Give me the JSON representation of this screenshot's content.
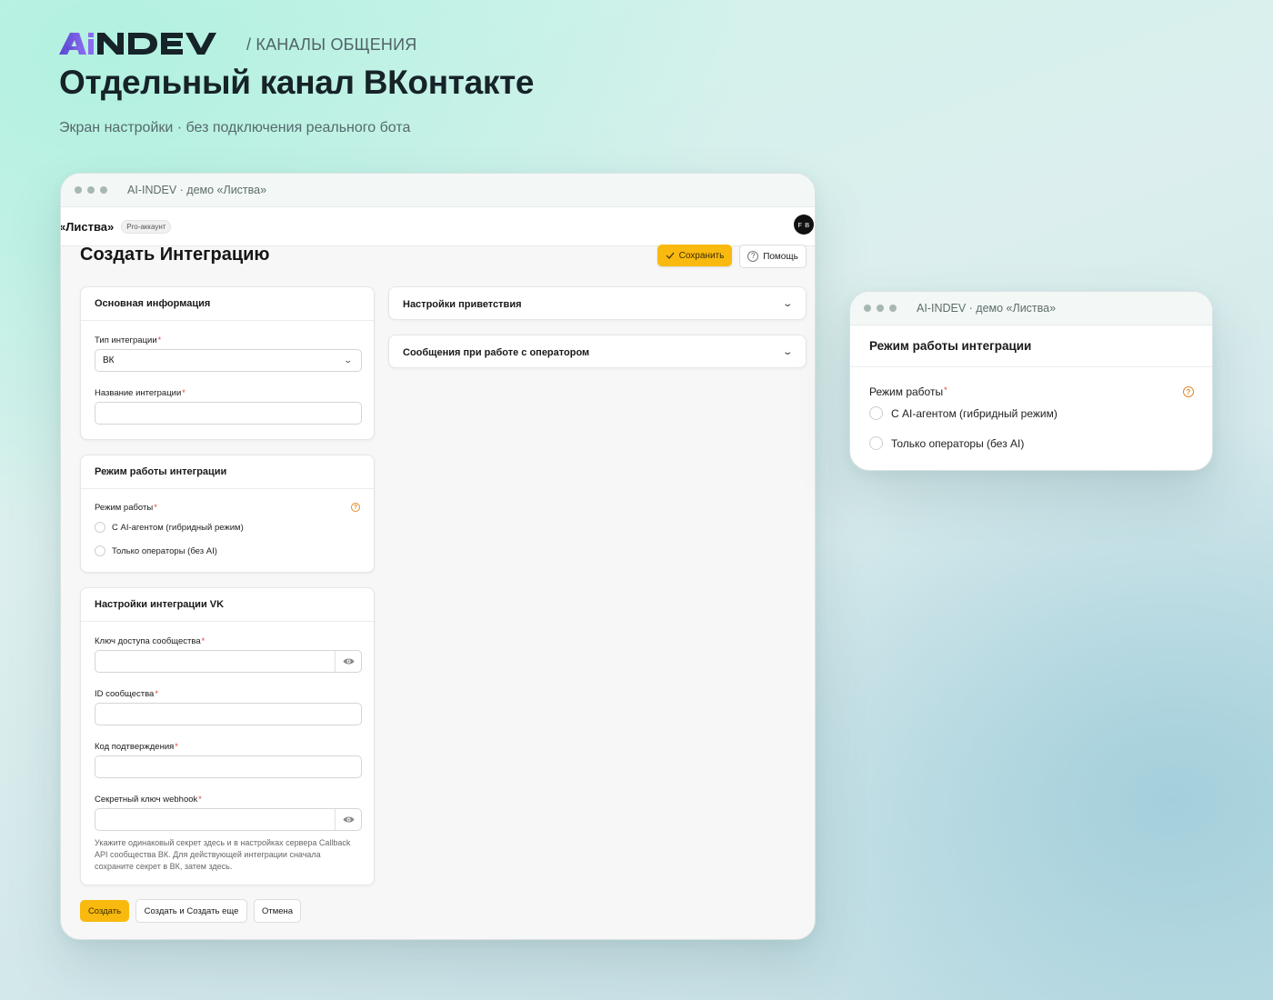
{
  "header": {
    "logo_text": "AiNDEV",
    "breadcrumb": "/ КАНАЛЫ ОБЩЕНИЯ",
    "title": "Отдельный канал ВКонтакте",
    "subtitle": "Экран настройки · без подключения реального бота"
  },
  "main_window": {
    "titlebar": "AI-INDEV · демо «Листва»",
    "org_name": "«Листва»",
    "account_badge": "Pro-аккаунт",
    "avatar_initials": "F B",
    "page_title": "Создать Интеграцию",
    "save_label": "Сохранить",
    "help_label": "Помощь",
    "basic_info": {
      "title": "Основная информация",
      "type_label": "Тип интеграции",
      "type_value": "ВК",
      "name_label": "Название интеграции",
      "name_value": ""
    },
    "mode": {
      "title": "Режим работы интеграции",
      "label": "Режим работы",
      "options": [
        "С AI-агентом (гибридный режим)",
        "Только операторы (без AI)"
      ]
    },
    "vk": {
      "title": "Настройки интеграции VK",
      "access_key_label": "Ключ доступа сообщества",
      "community_id_label": "ID сообщества",
      "confirm_code_label": "Код подтверждения",
      "secret_label": "Секретный ключ webhook",
      "hint": "Укажите одинаковый секрет здесь и в настройках сервера Callback API сообщества ВК. Для действующей интеграции сначала сохраните секрет в ВК, затем здесь."
    },
    "accordions": [
      "Настройки приветствия",
      "Сообщения при работе с оператором"
    ],
    "footer_buttons": {
      "create": "Создать",
      "create_more": "Создать и Создать еще",
      "cancel": "Отмена"
    }
  },
  "popup_window": {
    "titlebar": "AI-INDEV · демо «Листва»",
    "title": "Режим работы интеграции",
    "label": "Режим работы",
    "options": [
      "С AI-агентом (гибридный режим)",
      "Только операторы (без AI)"
    ]
  },
  "colors": {
    "accent": "#f9b90e",
    "required": "#e03c3c",
    "logo_violet": "#6e55d8",
    "logo_dark": "#162328"
  }
}
